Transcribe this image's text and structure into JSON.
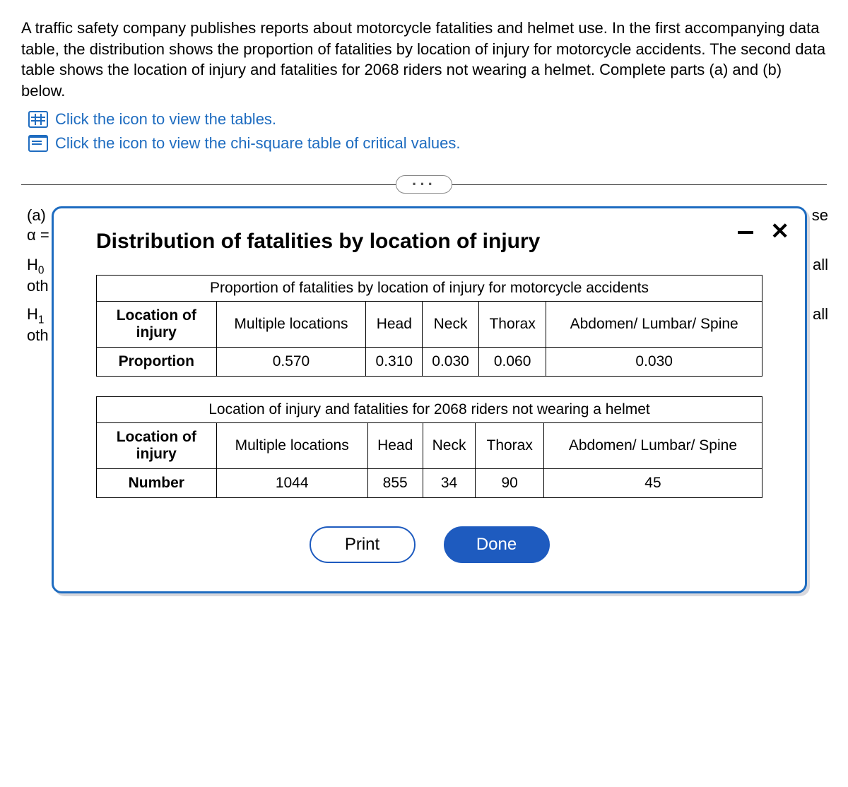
{
  "intro": "A traffic safety company publishes reports about motorcycle fatalities and helmet use. In the first accompanying data table, the distribution shows the proportion of fatalities by location of injury for motorcycle accidents. The second data table shows the location of injury and fatalities for 2068 riders not wearing a helmet. Complete parts (a) and (b) below.",
  "links": {
    "tables": "Click the icon to view the tables.",
    "chisq": "Click the icon to view the chi-square table of critical values."
  },
  "background": {
    "partA": "(a)",
    "alpha": "α =",
    "H0": "H",
    "H0sub": "0",
    "oth": "oth",
    "H1": "H",
    "H1sub": "1",
    "use": "se",
    "all": "all"
  },
  "popup": {
    "title": "Distribution of fatalities by location of injury",
    "table1": {
      "caption": "Proportion of fatalities by location of injury for motorcycle accidents",
      "rowHeader1": "Location of injury",
      "cols": [
        "Multiple locations",
        "Head",
        "Neck",
        "Thorax",
        "Abdomen/ Lumbar/ Spine"
      ],
      "rowHeader2": "Proportion",
      "vals": [
        "0.570",
        "0.310",
        "0.030",
        "0.060",
        "0.030"
      ]
    },
    "table2": {
      "caption": "Location of injury and fatalities for 2068 riders not wearing a helmet",
      "rowHeader1": "Location of injury",
      "cols": [
        "Multiple locations",
        "Head",
        "Neck",
        "Thorax",
        "Abdomen/ Lumbar/ Spine"
      ],
      "rowHeader2": "Number",
      "vals": [
        "1044",
        "855",
        "34",
        "90",
        "45"
      ]
    },
    "buttons": {
      "print": "Print",
      "done": "Done"
    }
  },
  "chart_data": [
    {
      "type": "table",
      "title": "Proportion of fatalities by location of injury for motorcycle accidents",
      "categories": [
        "Multiple locations",
        "Head",
        "Neck",
        "Thorax",
        "Abdomen/Lumbar/Spine"
      ],
      "series": [
        {
          "name": "Proportion",
          "values": [
            0.57,
            0.31,
            0.03,
            0.06,
            0.03
          ]
        }
      ]
    },
    {
      "type": "table",
      "title": "Location of injury and fatalities for 2068 riders not wearing a helmet",
      "categories": [
        "Multiple locations",
        "Head",
        "Neck",
        "Thorax",
        "Abdomen/Lumbar/Spine"
      ],
      "series": [
        {
          "name": "Number",
          "values": [
            1044,
            855,
            34,
            90,
            45
          ]
        }
      ]
    }
  ]
}
